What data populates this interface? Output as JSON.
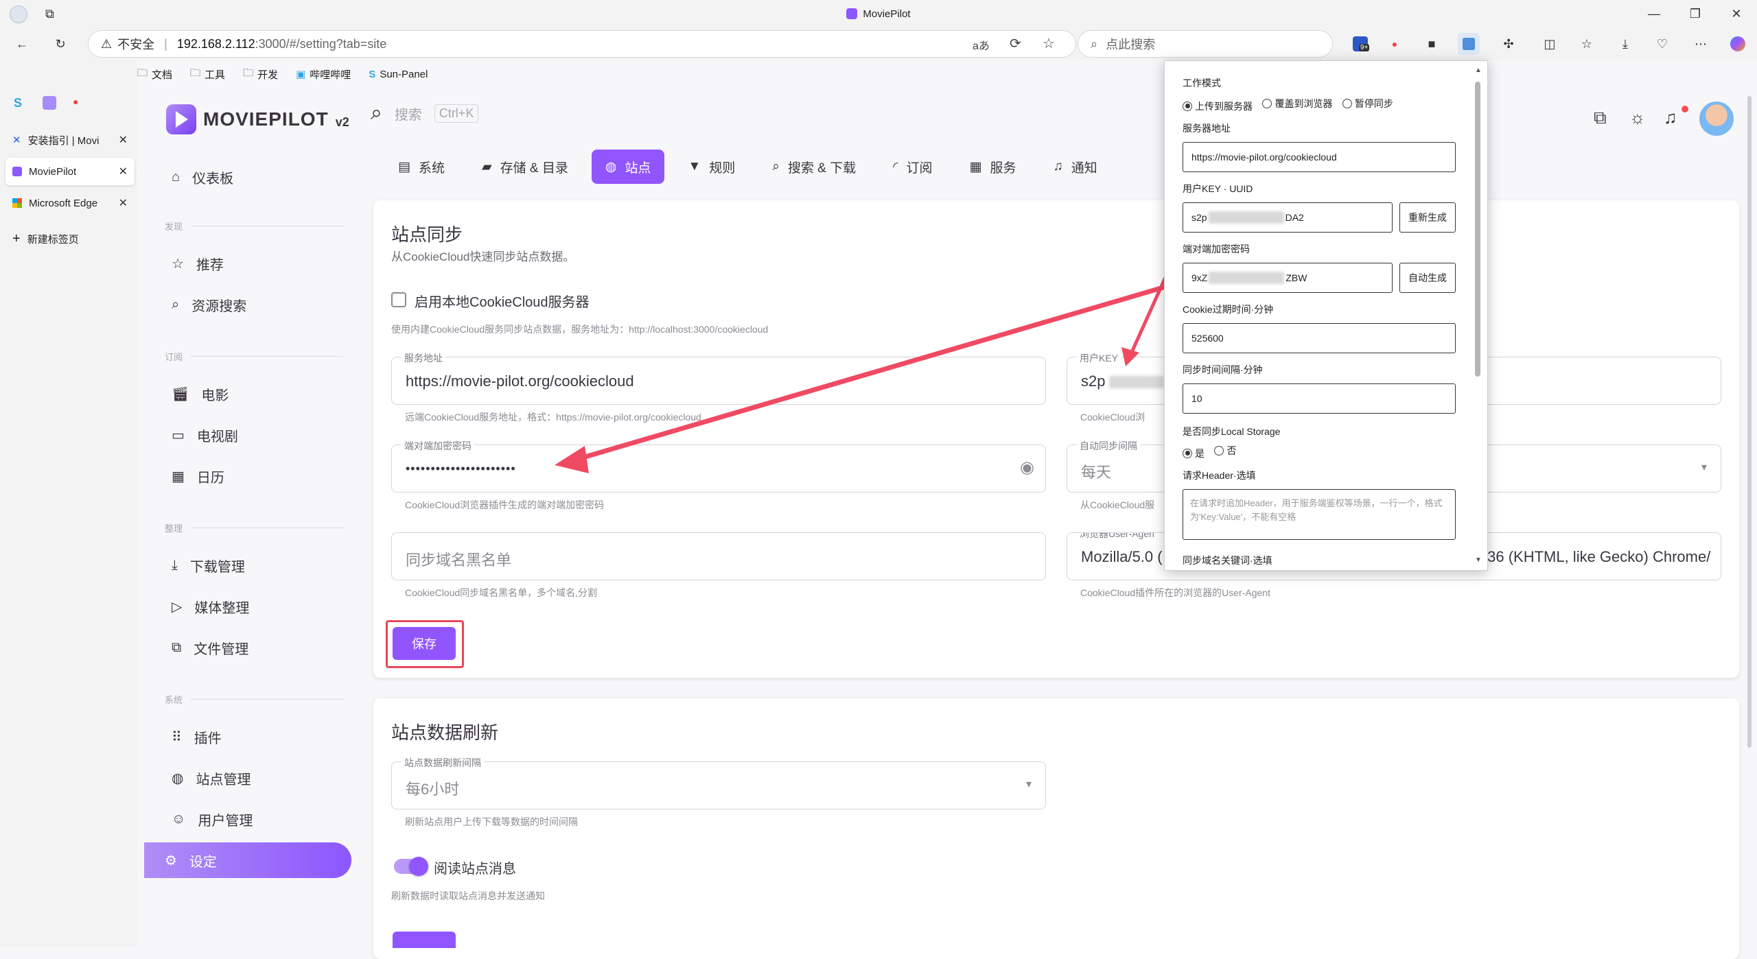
{
  "window": {
    "title": "MoviePilot"
  },
  "browser": {
    "security_label": "不安全",
    "url_host": "192.168.2.112",
    "url_rest": ":3000/#/setting?tab=site",
    "search_placeholder": "点此搜索",
    "badge_count": "9+",
    "bookmarks": [
      "文档",
      "工具",
      "开发",
      "哔哩哔哩",
      "Sun-Panel"
    ],
    "vtabs": [
      "安装指引 | Movi",
      "MoviePilot",
      "Microsoft Edge",
      "新建标签页"
    ]
  },
  "app": {
    "logo": "MOVIEPILOT",
    "logo_version": "v2",
    "search_placeholder": "搜索",
    "search_shortcut": "Ctrl+K"
  },
  "sidebar": {
    "dashboard": "仪表板",
    "sections": [
      "发现",
      "订阅",
      "整理",
      "系统"
    ],
    "items": [
      "推荐",
      "资源搜索",
      "电影",
      "电视剧",
      "日历",
      "下载管理",
      "媒体整理",
      "文件管理",
      "插件",
      "站点管理",
      "用户管理",
      "设定"
    ]
  },
  "tabs": [
    "系统",
    "存储 & 目录",
    "站点",
    "规则",
    "搜索 & 下载",
    "订阅",
    "服务",
    "通知"
  ],
  "sync_card": {
    "title": "站点同步",
    "subtitle": "从CookieCloud快速同步站点数据。",
    "local_checkbox_label": "启用本地CookieCloud服务器",
    "local_hint": "使用内建CookieCloud服务同步站点数据，服务地址为：http://localhost:3000/cookiecloud",
    "server_label": "服务地址",
    "server_value": "https://movie-pilot.org/cookiecloud",
    "server_hint": "远端CookieCloud服务地址，格式：https://movie-pilot.org/cookiecloud",
    "userkey_label": "用户KEY",
    "userkey_value": "s2p",
    "userkey_hint": "CookieCloud浏",
    "password_label": "端对端加密密码",
    "password_value": "••••••••••••••••••••••",
    "password_hint": "CookieCloud浏览器插件生成的端对端加密密码",
    "interval_label": "自动同步间隔",
    "interval_value": "每天",
    "interval_hint": "从CookieCloud服",
    "blacklist_placeholder": "同步域名黑名单",
    "blacklist_hint": "CookieCloud同步域名黑名单，多个域名,分割",
    "ua_label": "浏览器User-Agen",
    "ua_value_start": "Mozilla/5.0 (",
    "ua_value_end": ".36 (KHTML, like Gecko) Chrome/",
    "ua_hint": "CookieCloud插件所在的浏览器的User-Agent",
    "save_button": "保存"
  },
  "refresh_card": {
    "title": "站点数据刷新",
    "interval_label": "站点数据刷新间隔",
    "interval_value": "每6小时",
    "interval_hint": "刷新站点用户上传下载等数据的时间间隔",
    "toggle_label": "阅读站点消息",
    "toggle_hint": "刷新数据时读取站点消息并发送通知",
    "toggle_on": true
  },
  "popup": {
    "mode_label": "工作模式",
    "mode_options": [
      "上传到服务器",
      "覆盖到浏览器",
      "暂停同步"
    ],
    "server_label": "服务器地址",
    "server_value": "https://movie-pilot.org/cookiecloud",
    "uuid_label": "用户KEY · UUID",
    "uuid_start": "s2p",
    "uuid_end": "DA2",
    "regen_button": "重新生成",
    "password_label": "端对端加密密码",
    "password_start": "9xZ",
    "password_end": "ZBW",
    "autogen_button": "自动生成",
    "expire_label": "Cookie过期时间·分钟",
    "expire_value": "525600",
    "interval_label": "同步时间间隔·分钟",
    "interval_value": "10",
    "localstorage_label": "是否同步Local Storage",
    "localstorage_options": [
      "是",
      "否"
    ],
    "header_label": "请求Header·选填",
    "header_placeholder": "在请求时追加Header，用于服务端鉴权等场景，一行一个，格式为'Key:Value'，不能有空格",
    "keywords_label": "同步域名关键词·选填"
  },
  "colors": {
    "primary": "#9155fd",
    "highlight_box": "#e8465a",
    "arrow": "#f04a63"
  }
}
